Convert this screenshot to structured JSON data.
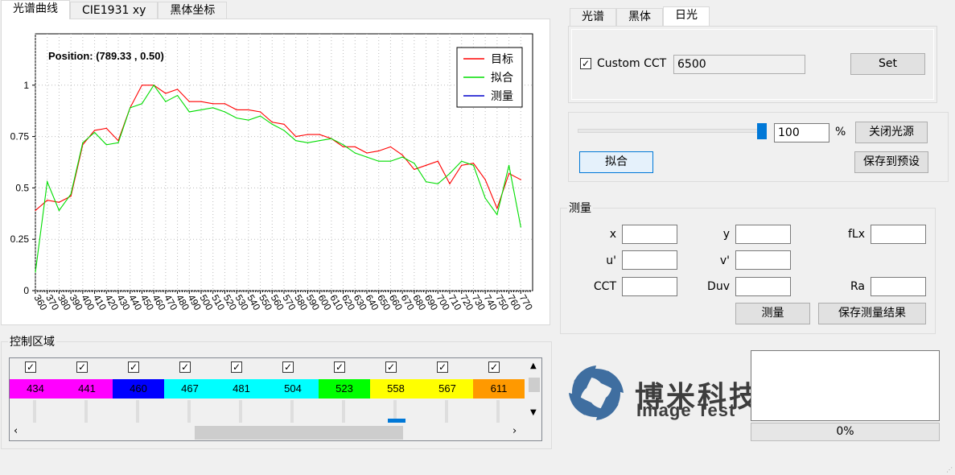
{
  "left_tabs": [
    "光谱曲线",
    "CIE1931 xy",
    "黑体坐标"
  ],
  "right_tabs": [
    "光谱",
    "黑体",
    "日光"
  ],
  "chart_data": {
    "type": "line",
    "annotation": "Position: (789.33 , 0.50)",
    "x": [
      360,
      370,
      380,
      390,
      400,
      410,
      420,
      430,
      440,
      450,
      460,
      470,
      480,
      490,
      500,
      510,
      520,
      530,
      540,
      550,
      560,
      570,
      580,
      590,
      600,
      610,
      620,
      630,
      640,
      650,
      660,
      670,
      680,
      690,
      700,
      710,
      720,
      730,
      740,
      750,
      760,
      770
    ],
    "xlim": [
      360,
      780
    ],
    "ylim": [
      0,
      1.25
    ],
    "yticks": [
      "0",
      "0.25",
      "0.5",
      "0.75",
      "1"
    ],
    "xticks": [
      "360",
      "370",
      "380",
      "390",
      "400",
      "410",
      "420",
      "430",
      "440",
      "450",
      "460",
      "470",
      "480",
      "490",
      "500",
      "510",
      "520",
      "530",
      "540",
      "550",
      "560",
      "570",
      "580",
      "590",
      "600",
      "610",
      "620",
      "630",
      "640",
      "650",
      "660",
      "670",
      "680",
      "690",
      "700",
      "710",
      "720",
      "730",
      "740",
      "750",
      "760",
      "770"
    ],
    "series": [
      {
        "name": "目标",
        "color": "#ff0000",
        "values": [
          0.39,
          0.44,
          0.43,
          0.46,
          0.71,
          0.78,
          0.79,
          0.73,
          0.89,
          1.0,
          1.0,
          0.96,
          0.98,
          0.92,
          0.92,
          0.91,
          0.91,
          0.88,
          0.88,
          0.87,
          0.82,
          0.81,
          0.75,
          0.76,
          0.76,
          0.74,
          0.7,
          0.7,
          0.67,
          0.68,
          0.7,
          0.66,
          0.59,
          0.61,
          0.63,
          0.52,
          0.61,
          0.62,
          0.54,
          0.4,
          0.57,
          0.54
        ]
      },
      {
        "name": "拟合",
        "color": "#00dd00",
        "values": [
          0.09,
          0.53,
          0.39,
          0.47,
          0.72,
          0.77,
          0.71,
          0.72,
          0.89,
          0.91,
          1.0,
          0.92,
          0.95,
          0.87,
          0.88,
          0.89,
          0.87,
          0.84,
          0.83,
          0.85,
          0.81,
          0.78,
          0.73,
          0.72,
          0.73,
          0.74,
          0.71,
          0.67,
          0.65,
          0.63,
          0.63,
          0.65,
          0.62,
          0.53,
          0.52,
          0.57,
          0.63,
          0.61,
          0.45,
          0.37,
          0.61,
          0.31
        ]
      },
      {
        "name": "测量",
        "color": "#0000cc",
        "values": []
      }
    ]
  },
  "daylight": {
    "custom_cct_label": "Custom CCT",
    "custom_cct_value": "6500",
    "set_label": "Set"
  },
  "light": {
    "slider_value": 1.0,
    "intensity_value": "100",
    "percent": "%",
    "close_label": "关闭光源",
    "fit_label": "拟合",
    "save_preset_label": "保存到预设"
  },
  "measure": {
    "title": "测量",
    "labels": {
      "x": "x",
      "y": "y",
      "flx": "fLx",
      "u": "u'",
      "v": "v'",
      "cct": "CCT",
      "duv": "Duv",
      "ra": "Ra"
    },
    "measure_label": "测量",
    "save_label": "保存测量结果"
  },
  "control": {
    "title": "控制区域",
    "channels": [
      {
        "label": "434",
        "color": "#ff00ff"
      },
      {
        "label": "441",
        "color": "#ff00ff"
      },
      {
        "label": "460",
        "color": "#0000ff"
      },
      {
        "label": "467",
        "color": "#00ffff"
      },
      {
        "label": "481",
        "color": "#00ffff"
      },
      {
        "label": "504",
        "color": "#00ffff"
      },
      {
        "label": "523",
        "color": "#00ff00"
      },
      {
        "label": "558",
        "color": "#ffff00"
      },
      {
        "label": "567",
        "color": "#ffff00"
      },
      {
        "label": "611",
        "color": "#ff9900"
      }
    ]
  },
  "logo": {
    "cn": "博米科技",
    "en": "Image Test"
  },
  "progress": {
    "text": "0%",
    "value": 0
  }
}
